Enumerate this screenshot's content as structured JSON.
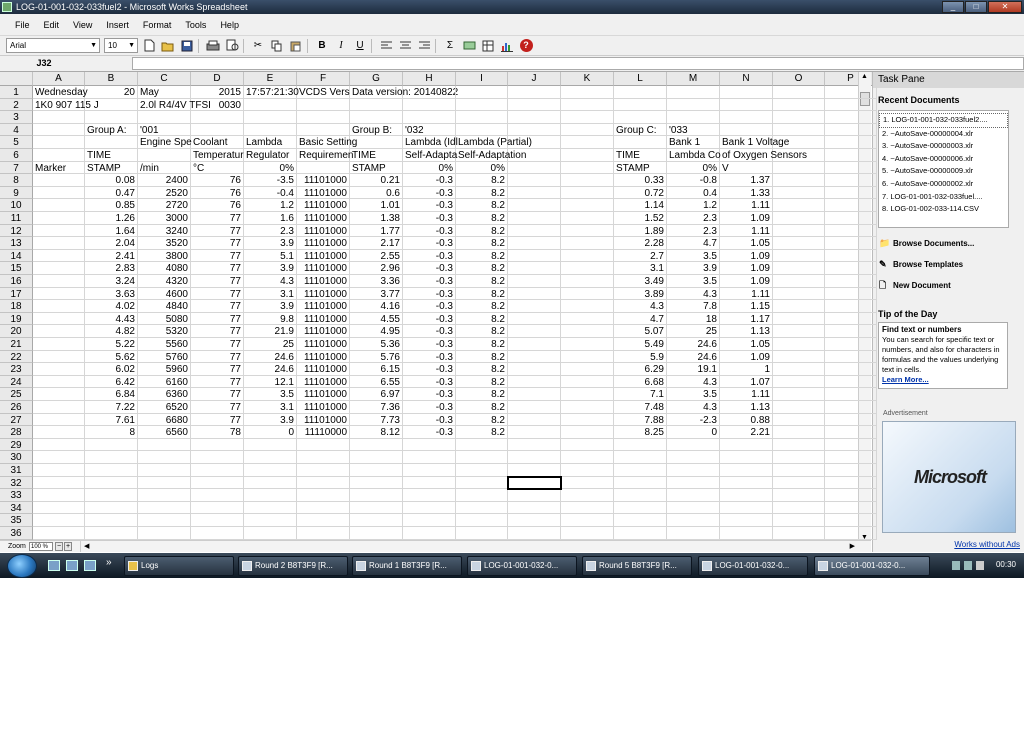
{
  "window": {
    "title": "LOG-01-001-032-033fuel2 - Microsoft Works Spreadsheet",
    "buttons": [
      "_",
      "□",
      "✕"
    ]
  },
  "menu": [
    "File",
    "Edit",
    "View",
    "Insert",
    "Format",
    "Tools",
    "Help"
  ],
  "toolbar": {
    "font": "Arial",
    "size": "10",
    "bold": "B",
    "italic": "I",
    "underline": "U",
    "sum": "Σ",
    "help": "?"
  },
  "formula": {
    "cell_ref": "J32",
    "content": ""
  },
  "columns": [
    "A",
    "B",
    "C",
    "D",
    "E",
    "F",
    "G",
    "H",
    "I",
    "J",
    "K",
    "L",
    "M",
    "N",
    "O",
    "P"
  ],
  "rows": [
    "1",
    "2",
    "3",
    "4",
    "5",
    "6",
    "7",
    "8",
    "9",
    "10",
    "11",
    "12",
    "13",
    "14",
    "15",
    "16",
    "17",
    "18",
    "19",
    "20",
    "21",
    "22",
    "23",
    "24",
    "25",
    "26",
    "27",
    "28",
    "29",
    "30",
    "31",
    "32",
    "33",
    "34",
    "35",
    "36"
  ],
  "sheet": [
    [
      "Wednesday",
      "20",
      "May",
      "2015",
      "17:57:21:30",
      "VCDS Vers",
      "Data version: 20140822",
      "",
      "",
      "",
      "",
      "",
      "",
      "",
      "",
      ""
    ],
    [
      "1K0 907 115 J",
      "",
      "2.0l R4/4V TFSI",
      "0030",
      "",
      "",
      "",
      "",
      "",
      "",
      "",
      "",
      "",
      "",
      "",
      ""
    ],
    [
      "",
      "",
      "",
      "",
      "",
      "",
      "",
      "",
      "",
      "",
      "",
      "",
      "",
      "",
      "",
      ""
    ],
    [
      "",
      "Group A:",
      "'001",
      "",
      "",
      "",
      "Group B:",
      "'032",
      "",
      "",
      "",
      "Group C:",
      "'033",
      "",
      "",
      ""
    ],
    [
      "",
      "",
      "Engine Spe",
      "Coolant",
      "Lambda",
      "Basic Setting",
      "",
      "Lambda (Idl",
      "Lambda (Partial)",
      "",
      "",
      "",
      "Bank 1",
      "Bank 1 Voltage",
      "",
      ""
    ],
    [
      "",
      "TIME",
      "",
      "Temperatur",
      "Regulator",
      "Requiremen",
      "TIME",
      "Self-Adapta",
      "Self-Adaptation",
      "",
      "",
      "TIME",
      "Lambda Co",
      "of Oxygen Sensors",
      "",
      ""
    ],
    [
      "Marker",
      "STAMP",
      "/min",
      "°C",
      "0%",
      "",
      "STAMP",
      "0%",
      "0%",
      "",
      "",
      "STAMP",
      "0%",
      "V",
      "",
      ""
    ],
    [
      "",
      "0.08",
      "2400",
      "76",
      "-3.5",
      "11101000",
      "0.21",
      "-0.3",
      "8.2",
      "",
      "",
      "0.33",
      "-0.8",
      "1.37",
      "",
      ""
    ],
    [
      "",
      "0.47",
      "2520",
      "76",
      "-0.4",
      "11101000",
      "0.6",
      "-0.3",
      "8.2",
      "",
      "",
      "0.72",
      "0.4",
      "1.33",
      "",
      ""
    ],
    [
      "",
      "0.85",
      "2720",
      "76",
      "1.2",
      "11101000",
      "1.01",
      "-0.3",
      "8.2",
      "",
      "",
      "1.14",
      "1.2",
      "1.11",
      "",
      ""
    ],
    [
      "",
      "1.26",
      "3000",
      "77",
      "1.6",
      "11101000",
      "1.38",
      "-0.3",
      "8.2",
      "",
      "",
      "1.52",
      "2.3",
      "1.09",
      "",
      ""
    ],
    [
      "",
      "1.64",
      "3240",
      "77",
      "2.3",
      "11101000",
      "1.77",
      "-0.3",
      "8.2",
      "",
      "",
      "1.89",
      "2.3",
      "1.11",
      "",
      ""
    ],
    [
      "",
      "2.04",
      "3520",
      "77",
      "3.9",
      "11101000",
      "2.17",
      "-0.3",
      "8.2",
      "",
      "",
      "2.28",
      "4.7",
      "1.05",
      "",
      ""
    ],
    [
      "",
      "2.41",
      "3800",
      "77",
      "5.1",
      "11101000",
      "2.55",
      "-0.3",
      "8.2",
      "",
      "",
      "2.7",
      "3.5",
      "1.09",
      "",
      ""
    ],
    [
      "",
      "2.83",
      "4080",
      "77",
      "3.9",
      "11101000",
      "2.96",
      "-0.3",
      "8.2",
      "",
      "",
      "3.1",
      "3.9",
      "1.09",
      "",
      ""
    ],
    [
      "",
      "3.24",
      "4320",
      "77",
      "4.3",
      "11101000",
      "3.36",
      "-0.3",
      "8.2",
      "",
      "",
      "3.49",
      "3.5",
      "1.09",
      "",
      ""
    ],
    [
      "",
      "3.63",
      "4600",
      "77",
      "3.1",
      "11101000",
      "3.77",
      "-0.3",
      "8.2",
      "",
      "",
      "3.89",
      "4.3",
      "1.11",
      "",
      ""
    ],
    [
      "",
      "4.02",
      "4840",
      "77",
      "3.9",
      "11101000",
      "4.16",
      "-0.3",
      "8.2",
      "",
      "",
      "4.3",
      "7.8",
      "1.15",
      "",
      ""
    ],
    [
      "",
      "4.43",
      "5080",
      "77",
      "9.8",
      "11101000",
      "4.55",
      "-0.3",
      "8.2",
      "",
      "",
      "4.7",
      "18",
      "1.17",
      "",
      ""
    ],
    [
      "",
      "4.82",
      "5320",
      "77",
      "21.9",
      "11101000",
      "4.95",
      "-0.3",
      "8.2",
      "",
      "",
      "5.07",
      "25",
      "1.13",
      "",
      ""
    ],
    [
      "",
      "5.22",
      "5560",
      "77",
      "25",
      "11101000",
      "5.36",
      "-0.3",
      "8.2",
      "",
      "",
      "5.49",
      "24.6",
      "1.05",
      "",
      ""
    ],
    [
      "",
      "5.62",
      "5760",
      "77",
      "24.6",
      "11101000",
      "5.76",
      "-0.3",
      "8.2",
      "",
      "",
      "5.9",
      "24.6",
      "1.09",
      "",
      ""
    ],
    [
      "",
      "6.02",
      "5960",
      "77",
      "24.6",
      "11101000",
      "6.15",
      "-0.3",
      "8.2",
      "",
      "",
      "6.29",
      "19.1",
      "1",
      "",
      ""
    ],
    [
      "",
      "6.42",
      "6160",
      "77",
      "12.1",
      "11101000",
      "6.55",
      "-0.3",
      "8.2",
      "",
      "",
      "6.68",
      "4.3",
      "1.07",
      "",
      ""
    ],
    [
      "",
      "6.84",
      "6360",
      "77",
      "3.5",
      "11101000",
      "6.97",
      "-0.3",
      "8.2",
      "",
      "",
      "7.1",
      "3.5",
      "1.11",
      "",
      ""
    ],
    [
      "",
      "7.22",
      "6520",
      "77",
      "3.1",
      "11101000",
      "7.36",
      "-0.3",
      "8.2",
      "",
      "",
      "7.48",
      "4.3",
      "1.13",
      "",
      ""
    ],
    [
      "",
      "7.61",
      "6680",
      "77",
      "3.9",
      "11101000",
      "7.73",
      "-0.3",
      "8.2",
      "",
      "",
      "7.88",
      "-2.3",
      "0.88",
      "",
      ""
    ],
    [
      "",
      "8",
      "6560",
      "78",
      "0",
      "11110000",
      "8.12",
      "-0.3",
      "8.2",
      "",
      "",
      "8.25",
      "0",
      "2.21",
      "",
      ""
    ]
  ],
  "bottom": {
    "zoom_label": "Zoom",
    "zoom_value": "100 %",
    "minus": "−",
    "plus": "+"
  },
  "taskpane": {
    "title": "Task Pane",
    "recent_heading": "Recent Documents",
    "recent": [
      "1. LOG-01-001-032-033fuel2....",
      "2. ~AutoSave-00000004.xlr",
      "3. ~AutoSave-00000003.xlr",
      "4. ~AutoSave-00000006.xlr",
      "5. ~AutoSave-00000009.xlr",
      "6. ~AutoSave-00000002.xlr",
      "7. LOG-01-001-032-033fuel....",
      "8. LOG-01-002-033-114.CSV"
    ],
    "browse_documents": "Browse Documents...",
    "browse_templates": "Browse Templates",
    "new_document": "New Document",
    "tip_heading": "Tip of the Day",
    "tip_title": "Find text or numbers",
    "tip_body": "You can search for specific text or numbers, and also for characters in formulas and the values underlying text in cells.",
    "learn_more": "Learn More...",
    "ad_label": "Advertisement",
    "ad_brand": "Microsoft",
    "works_link": "Works without Ads"
  },
  "taskbar": {
    "chevron": "»",
    "items": [
      "Logs",
      "Round 2 B8T3F9 [R...",
      "Round 1 B8T3F9 [R...",
      "LOG-01-001-032-0...",
      "Round 5 B8T3F9 [R...",
      "LOG-01-001-032-0...",
      "LOG-01-001-032-0..."
    ],
    "clock": "00:30"
  }
}
